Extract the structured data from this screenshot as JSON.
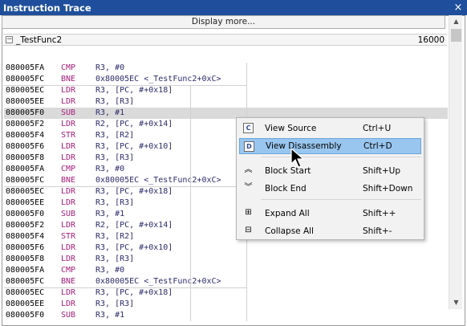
{
  "window": {
    "title": "Instruction Trace",
    "close_glyph": "×"
  },
  "display_more": "Display more...",
  "group": {
    "name": "_TestFunc2",
    "count": "16000",
    "expander": "−"
  },
  "rows": [
    {
      "addr": "080005FA",
      "mn": "CMP",
      "ops": "R3, #0"
    },
    {
      "addr": "080005FC",
      "mn": "BNE",
      "ops": "0x80005EC <_TestFunc2+0xC>"
    },
    {
      "addr": "080005EC",
      "mn": "LDR",
      "ops": "R3, [PC, #+0x18]"
    },
    {
      "addr": "080005EE",
      "mn": "LDR",
      "ops": "R3, [R3]"
    },
    {
      "addr": "080005F0",
      "mn": "SUB",
      "ops": "R3, #1"
    },
    {
      "addr": "080005F2",
      "mn": "LDR",
      "ops": "R2, [PC, #+0x14]"
    },
    {
      "addr": "080005F4",
      "mn": "STR",
      "ops": "R3, [R2]"
    },
    {
      "addr": "080005F6",
      "mn": "LDR",
      "ops": "R3, [PC, #+0x10]"
    },
    {
      "addr": "080005F8",
      "mn": "LDR",
      "ops": "R3, [R3]"
    },
    {
      "addr": "080005FA",
      "mn": "CMP",
      "ops": "R3, #0"
    },
    {
      "addr": "080005FC",
      "mn": "BNE",
      "ops": "0x80005EC <_TestFunc2+0xC>"
    },
    {
      "addr": "080005EC",
      "mn": "LDR",
      "ops": "R3, [PC, #+0x18]"
    },
    {
      "addr": "080005EE",
      "mn": "LDR",
      "ops": "R3, [R3]"
    },
    {
      "addr": "080005F0",
      "mn": "SUB",
      "ops": "R3, #1"
    },
    {
      "addr": "080005F2",
      "mn": "LDR",
      "ops": "R2, [PC, #+0x14]"
    },
    {
      "addr": "080005F4",
      "mn": "STR",
      "ops": "R3, [R2]"
    },
    {
      "addr": "080005F6",
      "mn": "LDR",
      "ops": "R3, [PC, #+0x10]"
    },
    {
      "addr": "080005F8",
      "mn": "LDR",
      "ops": "R3, [R3]"
    },
    {
      "addr": "080005FA",
      "mn": "CMP",
      "ops": "R3, #0"
    },
    {
      "addr": "080005FC",
      "mn": "BNE",
      "ops": "0x80005EC <_TestFunc2+0xC>"
    },
    {
      "addr": "080005EC",
      "mn": "LDR",
      "ops": "R3, [PC, #+0x18]"
    },
    {
      "addr": "080005EE",
      "mn": "LDR",
      "ops": "R3, [R3]"
    },
    {
      "addr": "080005F0",
      "mn": "SUB",
      "ops": "R3, #1"
    }
  ],
  "context_menu": {
    "items": [
      {
        "label": "View Source",
        "shortcut": "Ctrl+U",
        "icon": "view-source-icon",
        "glyph": "C"
      },
      {
        "label": "View Disassembly",
        "shortcut": "Ctrl+D",
        "icon": "view-disassembly-icon",
        "glyph": "D",
        "active": true
      },
      {
        "label": "Block Start",
        "shortcut": "Shift+Up",
        "icon": "chevron-double-up-icon",
        "glyph": "︽"
      },
      {
        "label": "Block End",
        "shortcut": "Shift+Down",
        "icon": "chevron-double-down-icon",
        "glyph": "︾"
      },
      {
        "label": "Expand All",
        "shortcut": "Shift++",
        "icon": "expand-all-icon",
        "glyph": "⊞"
      },
      {
        "label": "Collapse All",
        "shortcut": "Shift+-",
        "icon": "collapse-all-icon",
        "glyph": "⊟"
      }
    ]
  },
  "colors": {
    "titlebar": "#1f4f9c",
    "mnemonic": "#a51d7a",
    "highlight_row": "#dadada",
    "menu_active": "#98c6ef"
  }
}
